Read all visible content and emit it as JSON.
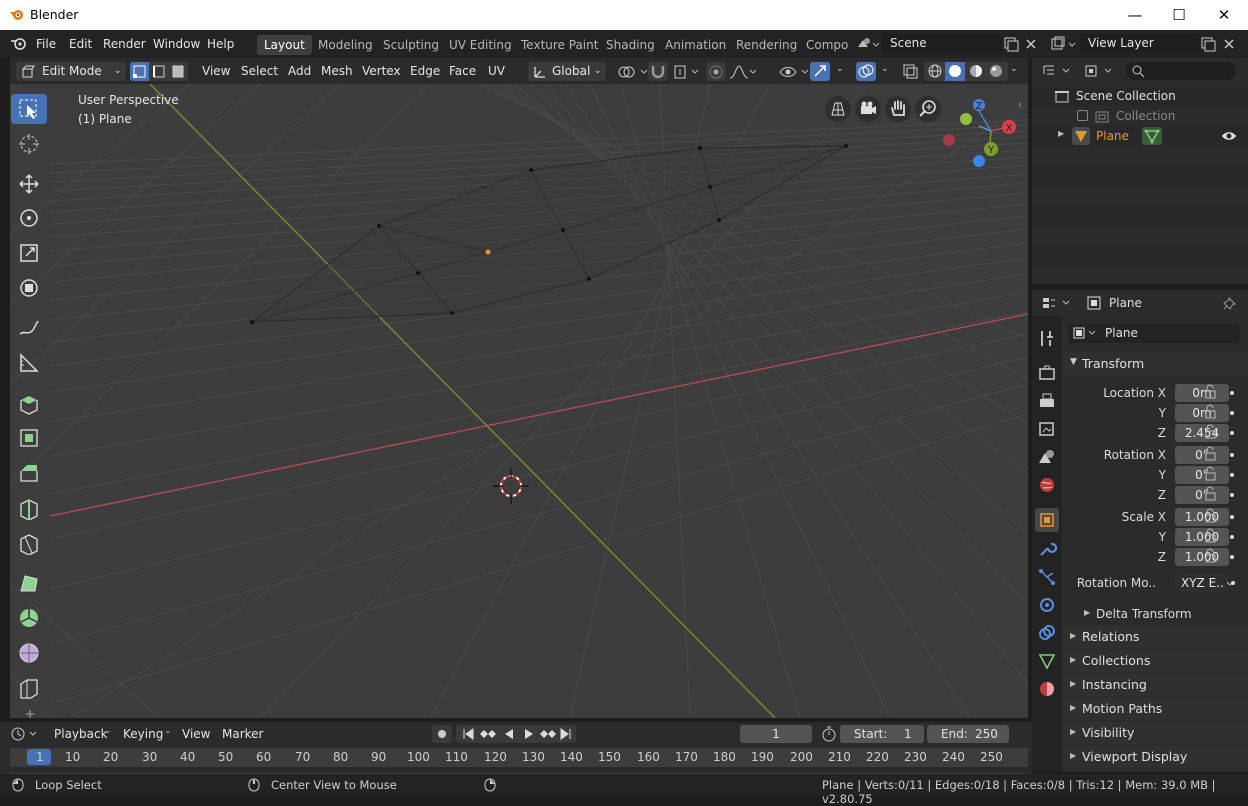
{
  "window": {
    "title": "Blender",
    "minimize": "—",
    "maximize": "☐",
    "close": "✕"
  },
  "menus": [
    "File",
    "Edit",
    "Render",
    "Window",
    "Help"
  ],
  "workspaces": [
    "Layout",
    "Modeling",
    "Sculpting",
    "UV Editing",
    "Texture Paint",
    "Shading",
    "Animation",
    "Rendering",
    "Compo"
  ],
  "scene_name": "Scene",
  "view_layer": "View Layer",
  "viewport_header": {
    "mode": "Edit Mode",
    "menus": [
      "View",
      "Select",
      "Add",
      "Mesh",
      "Vertex",
      "Edge",
      "Face",
      "UV"
    ],
    "orientation": "Global"
  },
  "viewport": {
    "perspective": "User Perspective",
    "object": "(1) Plane",
    "gizmo": {
      "x": "X",
      "y": "Y",
      "z": "Z"
    }
  },
  "outliner": {
    "root": "Scene Collection",
    "collection": "Collection",
    "object": "Plane"
  },
  "properties": {
    "object_name": "Plane",
    "data_name": "Plane",
    "transform_title": "Transform",
    "location": {
      "label": "Location X",
      "x": "0m",
      "y": "0m",
      "z": "2.454"
    },
    "rotation": {
      "label": "Rotation X",
      "x": "0°",
      "y": "0°",
      "z": "0°"
    },
    "scale": {
      "label": "Scale X",
      "x": "1.000",
      "y": "1.000",
      "z": "1.000"
    },
    "axis_y": "Y",
    "axis_z": "Z",
    "rotation_mode_label": "Rotation Mo..",
    "rotation_mode_value": "XYZ E..",
    "delta": "Delta Transform",
    "sections": [
      "Relations",
      "Collections",
      "Instancing",
      "Motion Paths",
      "Visibility",
      "Viewport Display"
    ]
  },
  "timeline": {
    "menus": [
      "Playback",
      "Keying",
      "View",
      "Marker"
    ],
    "current_frame": "1",
    "start_label": "Start:",
    "start": "1",
    "end_label": "End:",
    "end": "250",
    "ruler": [
      "1",
      "10",
      "20",
      "30",
      "40",
      "50",
      "60",
      "70",
      "80",
      "90",
      "100",
      "110",
      "120",
      "130",
      "140",
      "150",
      "160",
      "170",
      "180",
      "190",
      "200",
      "210",
      "220",
      "230",
      "240",
      "250"
    ]
  },
  "status": {
    "left_action": "Loop Select",
    "mid_action": "Center View to Mouse",
    "stats": "Plane | Verts:0/11 | Edges:0/18 | Faces:0/8 | Tris:12 | Mem: 39.0 MB | v2.80.75"
  },
  "colors": {
    "accent": "#4772b3",
    "x_axis": "#b44a55",
    "y_axis": "#7a8f2c",
    "object_orange": "#e8962c"
  }
}
